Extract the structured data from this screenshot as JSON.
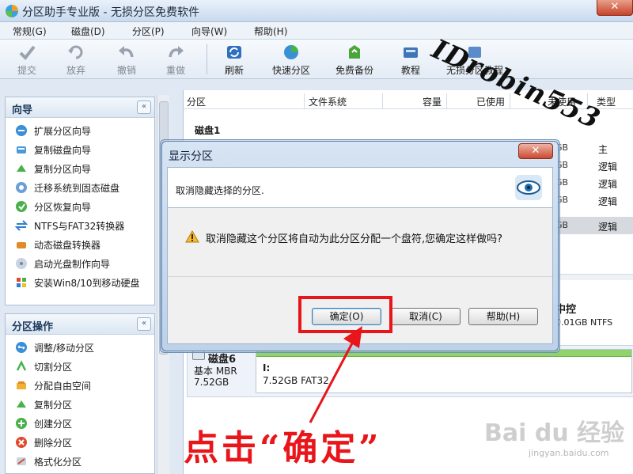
{
  "window": {
    "title": "分区助手专业版 - 无损分区免费软件",
    "close_glyph": "✕"
  },
  "menu": [
    "常规(G)",
    "磁盘(D)",
    "分区(P)",
    "向导(W)",
    "帮助(H)"
  ],
  "toolbar": [
    {
      "label": "提交",
      "icon": "check-icon",
      "enabled": false
    },
    {
      "label": "放弃",
      "icon": "discard-icon",
      "enabled": false
    },
    {
      "label": "撤销",
      "icon": "undo-icon",
      "enabled": false
    },
    {
      "label": "重做",
      "icon": "redo-icon",
      "enabled": false
    },
    {
      "label": "刷新",
      "icon": "refresh-icon",
      "enabled": true
    },
    {
      "label": "快速分区",
      "icon": "quick-partition-icon",
      "enabled": true
    },
    {
      "label": "免费备份",
      "icon": "backup-icon",
      "enabled": true
    },
    {
      "label": "教程",
      "icon": "tutorial-icon",
      "enabled": true
    },
    {
      "label": "无损分区教程",
      "icon": "lossless-tutorial-icon",
      "enabled": true
    }
  ],
  "wizard_panel": {
    "title": "向导",
    "collapse_glyph": "«",
    "items": [
      "扩展分区向导",
      "复制磁盘向导",
      "复制分区向导",
      "迁移系统到固态磁盘",
      "分区恢复向导",
      "NTFS与FAT32转换器",
      "动态磁盘转换器",
      "启动光盘制作向导",
      "安装Win8/10到移动硬盘"
    ]
  },
  "ops_panel": {
    "title": "分区操作",
    "collapse_glyph": "«",
    "items": [
      "调整/移动分区",
      "切割分区",
      "分配自由空间",
      "复制分区",
      "创建分区",
      "删除分区",
      "格式化分区"
    ]
  },
  "columns": [
    "分区",
    "文件系统",
    "容量",
    "已使用",
    "未使用",
    "类型"
  ],
  "disk1_label": "磁盘1",
  "partition_rows": [
    {
      "size": "GB",
      "type": "主",
      "selected": false
    },
    {
      "size": "GB",
      "type": "逻辑",
      "selected": false
    },
    {
      "size": "GB",
      "type": "逻辑",
      "selected": false
    },
    {
      "size": "GB",
      "type": "逻辑",
      "selected": false
    },
    {
      "size": "GB",
      "type": "逻辑",
      "selected": true
    }
  ],
  "disk5_partition": {
    "name": "中控",
    "size": "0.01GB NTFS"
  },
  "disk6": {
    "name": "磁盘6",
    "type": "基本 MBR",
    "size": "7.52GB",
    "partition_label": "I:",
    "partition_info": "7.52GB FAT32"
  },
  "watermark": "IDrobin553",
  "dialog": {
    "title": "显示分区",
    "close_glyph": "✕",
    "header_message": "取消隐藏选择的分区.",
    "warning_text": "取消隐藏这个分区将自动为此分区分配一个盘符,您确定这样做吗?",
    "ok": "确定(O)",
    "cancel": "取消(C)",
    "help": "帮助(H)"
  },
  "annotation": "点击“确定”",
  "baidu": {
    "logo": "Bai du 经验",
    "url": "jingyan.baidu.com"
  },
  "colors": {
    "highlight_red": "#e8151b",
    "accent_blue": "#3c7fb1"
  }
}
